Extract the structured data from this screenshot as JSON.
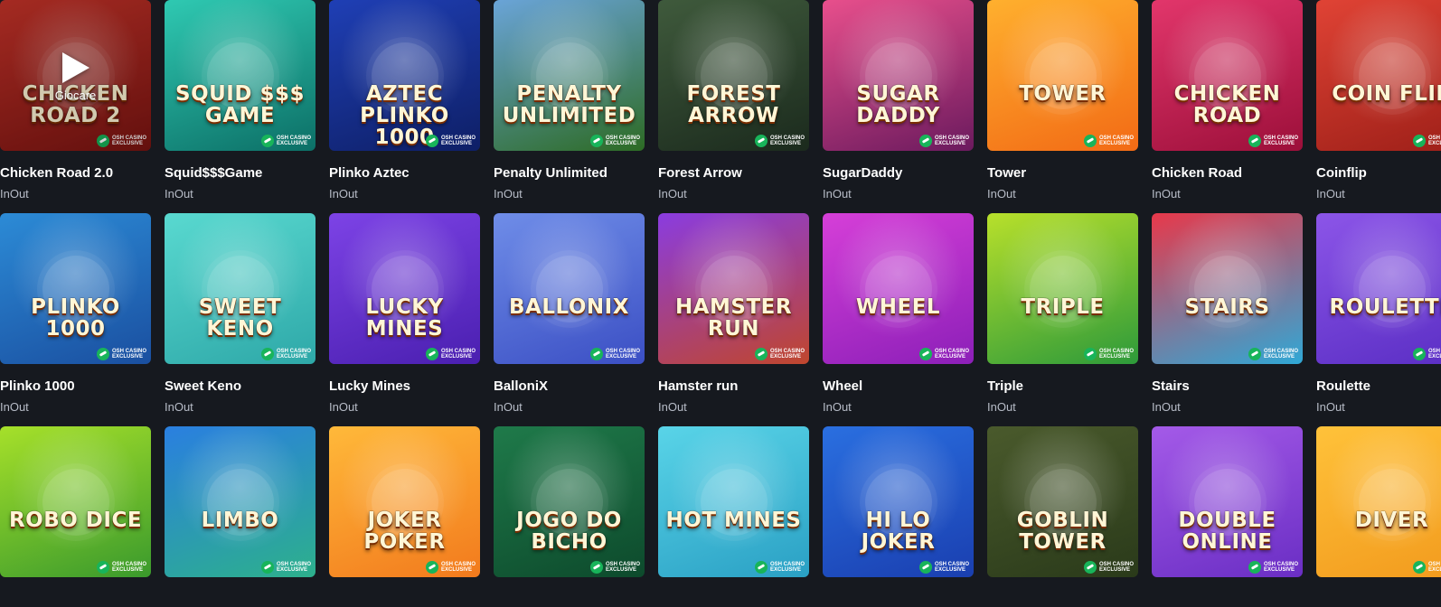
{
  "games": [
    {
      "title": "Chicken Road 2.0",
      "provider": "InOut",
      "logo": "Chicken Road 2",
      "colors": [
        "#c9342a",
        "#7a1411"
      ],
      "badge": "OSH CASINO\nEXCLUSIVE",
      "hover": true,
      "play_label": "Giocare"
    },
    {
      "title": "Squid$$$Game",
      "provider": "InOut",
      "logo": "Squid $$$ Game",
      "colors": [
        "#2fc9b2",
        "#0c6f66"
      ],
      "badge": "OSH CASINO\nEXCLUSIVE"
    },
    {
      "title": "Plinko Aztec",
      "provider": "InOut",
      "logo": "Aztec Plinko 1000",
      "colors": [
        "#1f3fb5",
        "#0e1f66"
      ],
      "badge": "OSH CASINO\nEXCLUSIVE"
    },
    {
      "title": "Penalty Unlimited",
      "provider": "InOut",
      "logo": "Penalty Unlimited",
      "colors": [
        "#6aa4d8",
        "#2d6b24"
      ],
      "badge": "OSH CASINO\nEXCLUSIVE"
    },
    {
      "title": "Forest Arrow",
      "provider": "InOut",
      "logo": "Forest Arrow",
      "colors": [
        "#3f5a3c",
        "#1b2a1d"
      ],
      "badge": "OSH CASINO\nEXCLUSIVE"
    },
    {
      "title": "SugarDaddy",
      "provider": "InOut",
      "logo": "Sugar Daddy",
      "colors": [
        "#e84f8c",
        "#6b1a5e"
      ],
      "badge": "OSH CASINO\nEXCLUSIVE"
    },
    {
      "title": "Tower",
      "provider": "InOut",
      "logo": "Tower",
      "colors": [
        "#ffb02e",
        "#f26a15"
      ],
      "badge": "OSH CASINO\nEXCLUSIVE"
    },
    {
      "title": "Chicken Road",
      "provider": "InOut",
      "logo": "Chicken Road",
      "colors": [
        "#e2366b",
        "#9c0f3a"
      ],
      "badge": "OSH CASINO\nEXCLUSIVE"
    },
    {
      "title": "Coinflip",
      "provider": "InOut",
      "logo": "Coin Flip",
      "colors": [
        "#e04335",
        "#9d1f18"
      ],
      "badge": "OSH CASINO\nEXCLUSIVE"
    },
    {
      "title": "Plinko 1000",
      "provider": "InOut",
      "logo": "Plinko 1000",
      "colors": [
        "#2c8bd6",
        "#1a4fa0"
      ],
      "badge": "OSH CASINO\nEXCLUSIVE"
    },
    {
      "title": "Sweet Keno",
      "provider": "InOut",
      "logo": "Sweet Keno",
      "colors": [
        "#59d9d0",
        "#2ea8a8"
      ],
      "badge": "OSH CASINO\nEXCLUSIVE"
    },
    {
      "title": "Lucky Mines",
      "provider": "InOut",
      "logo": "Lucky Mines",
      "colors": [
        "#7d43e6",
        "#4a1fb0"
      ],
      "badge": "OSH CASINO\nEXCLUSIVE"
    },
    {
      "title": "BalloniX",
      "provider": "InOut",
      "logo": "Ballonix",
      "colors": [
        "#6f8de8",
        "#3b4fc4"
      ],
      "badge": "OSH CASINO\nEXCLUSIVE"
    },
    {
      "title": "Hamster run",
      "provider": "InOut",
      "logo": "Hamster Run",
      "colors": [
        "#8a3ce0",
        "#c0462d"
      ],
      "badge": "OSH CASINO\nEXCLUSIVE"
    },
    {
      "title": "Wheel",
      "provider": "InOut",
      "logo": "Wheel",
      "colors": [
        "#d63fd8",
        "#8c1fb8"
      ],
      "badge": "OSH CASINO\nEXCLUSIVE"
    },
    {
      "title": "Triple",
      "provider": "InOut",
      "logo": "Triple",
      "colors": [
        "#b8e02b",
        "#2d9a3a"
      ],
      "badge": "OSH CASINO\nEXCLUSIVE"
    },
    {
      "title": "Stairs",
      "provider": "InOut",
      "logo": "Stairs",
      "colors": [
        "#e8384a",
        "#2fa8d6"
      ],
      "badge": "OSH CASINO\nEXCLUSIVE"
    },
    {
      "title": "Roulette",
      "provider": "InOut",
      "logo": "Roulette",
      "colors": [
        "#8c55e8",
        "#5a2ec4"
      ],
      "badge": "OSH CASINO\nEXCLUSIVE"
    },
    {
      "title": "",
      "provider": "",
      "logo": "Robo Dice",
      "colors": [
        "#a6e02a",
        "#3a9a2c"
      ],
      "badge": "OSH CASINO\nEXCLUSIVE"
    },
    {
      "title": "",
      "provider": "",
      "logo": "Limbo",
      "colors": [
        "#2a7fe0",
        "#2db08c"
      ],
      "badge": "OSH CASINO\nEXCLUSIVE"
    },
    {
      "title": "",
      "provider": "",
      "logo": "Joker Poker",
      "colors": [
        "#ffb93a",
        "#f27a1d"
      ],
      "badge": "OSH CASINO\nEXCLUSIVE"
    },
    {
      "title": "",
      "provider": "",
      "logo": "Jogo do Bicho",
      "colors": [
        "#1f7a4a",
        "#0d4a2c"
      ],
      "badge": "OSH CASINO\nEXCLUSIVE"
    },
    {
      "title": "",
      "provider": "",
      "logo": "Hot Mines",
      "colors": [
        "#59d4e8",
        "#2aa0c4"
      ],
      "badge": "OSH CASINO\nEXCLUSIVE"
    },
    {
      "title": "",
      "provider": "",
      "logo": "Hi Lo Joker",
      "colors": [
        "#2a6fe0",
        "#1a3fb0"
      ],
      "badge": "OSH CASINO\nEXCLUSIVE"
    },
    {
      "title": "",
      "provider": "",
      "logo": "Goblin Tower",
      "colors": [
        "#4a5a2c",
        "#2a3a1a"
      ],
      "badge": "OSH CASINO\nEXCLUSIVE"
    },
    {
      "title": "",
      "provider": "",
      "logo": "Double Online",
      "colors": [
        "#a45ae8",
        "#6a2ec4"
      ],
      "badge": "OSH CASINO\nEXCLUSIVE"
    },
    {
      "title": "",
      "provider": "",
      "logo": "Diver",
      "colors": [
        "#ffc23a",
        "#f29a1d"
      ],
      "badge": "OSH CASINO\nEXCLUSIVE"
    }
  ]
}
